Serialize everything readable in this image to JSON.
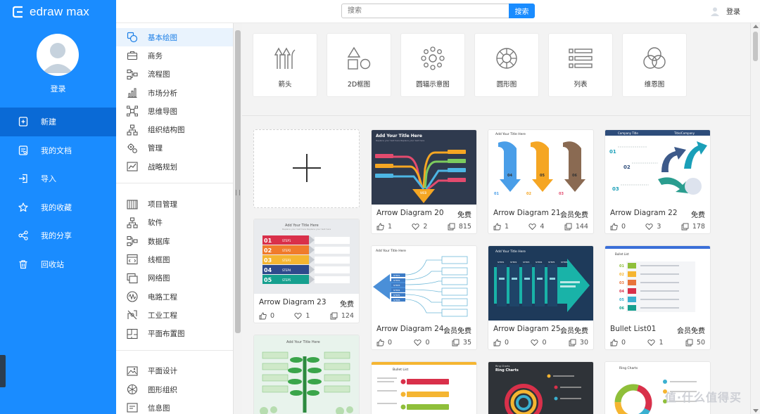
{
  "app": {
    "logo_text": "edraw max"
  },
  "sidebar": {
    "login_label": "登录",
    "items": [
      {
        "label": "新建",
        "icon": "new-file-icon",
        "active": true
      },
      {
        "label": "我的文档",
        "icon": "document-icon",
        "active": false
      },
      {
        "label": "导入",
        "icon": "import-icon",
        "active": false
      },
      {
        "label": "我的收藏",
        "icon": "star-icon",
        "active": false
      },
      {
        "label": "我的分享",
        "icon": "share-icon",
        "active": false
      },
      {
        "label": "回收站",
        "icon": "trash-icon",
        "active": false
      }
    ]
  },
  "header": {
    "search_placeholder": "搜索",
    "search_button": "搜索",
    "login": "登录"
  },
  "categories": {
    "group1": [
      "基本绘图",
      "商务",
      "流程图",
      "市场分析",
      "思维导图",
      "组织结构图",
      "管理",
      "战略规划"
    ],
    "group2": [
      "项目管理",
      "软件",
      "数据库",
      "线框图",
      "网络图",
      "电路工程",
      "工业工程",
      "平面布置图"
    ],
    "group3": [
      "平面设计",
      "图形组织",
      "信息图"
    ]
  },
  "diagram_types": [
    {
      "label": "箭头",
      "icon": "arrows-icon"
    },
    {
      "label": "2D框图",
      "icon": "2d-shapes-icon"
    },
    {
      "label": "圆辐示意图",
      "icon": "radial-icon"
    },
    {
      "label": "圆形图",
      "icon": "circle-chart-icon"
    },
    {
      "label": "列表",
      "icon": "list-icon"
    },
    {
      "label": "维恩图",
      "icon": "venn-icon"
    }
  ],
  "templates": [
    {
      "name": "Arrow Diagram 20",
      "badge": "免费",
      "likes": "1",
      "comments": "2",
      "copies": "815"
    },
    {
      "name": "Arrow Diagram 21",
      "badge": "会员免费",
      "likes": "1",
      "comments": "4",
      "copies": "144"
    },
    {
      "name": "Arrow Diagram 22",
      "badge": "免费",
      "likes": "0",
      "comments": "3",
      "copies": "178"
    },
    {
      "name": "Arrow Diagram 23",
      "badge": "免费",
      "likes": "0",
      "comments": "1",
      "copies": "124"
    },
    {
      "name": "Arrow Diagram 24",
      "badge": "会员免费",
      "likes": "0",
      "comments": "0",
      "copies": "35"
    },
    {
      "name": "Arrow Diagram 25",
      "badge": "会员免费",
      "likes": "0",
      "comments": "0",
      "copies": "30"
    },
    {
      "name": "Bullet List01",
      "badge": "会员免费",
      "likes": "0",
      "comments": "1",
      "copies": "50"
    }
  ],
  "thumb_text": {
    "t20_title": "Add Your Title Here",
    "t20_caption": "Replace your text here  Replace your text here",
    "t20_tip": "WEB",
    "t21_title": "Add Your Title Here",
    "t21_nums": [
      "01",
      "04",
      "02",
      "05",
      "03",
      "06"
    ],
    "t22_title": "Company Title",
    "t22_sub": "Title/Company",
    "t22_nums": [
      "01",
      "02",
      "03"
    ],
    "t23_title": "Add Your Title Here",
    "t23_subtitle": "Replace your text here  Replace your text here",
    "t23_steps": [
      {
        "num": "01",
        "label": "STEP1"
      },
      {
        "num": "02",
        "label": "STEP2"
      },
      {
        "num": "03",
        "label": "STEP3"
      },
      {
        "num": "04",
        "label": "STEP4"
      },
      {
        "num": "05",
        "label": "STEP5"
      }
    ],
    "t24_title": "Add Your Title Here",
    "t24_steps": [
      "STEP1",
      "STEP2",
      "STEP3",
      "STEP4",
      "STEP5",
      "STEP6"
    ],
    "t25_title": "Add Your Title Here",
    "t25_steps": [
      "STEP1",
      "STEP2",
      "STEP3",
      "STEP4",
      "STEP5",
      "STEP6"
    ],
    "tb_title": "Bullet List",
    "tb_nums": [
      "01",
      "02",
      "03",
      "04",
      "05",
      "06"
    ],
    "r1_title": "Add Your Title Here",
    "r2_title": "Bullet List",
    "r3_title": "Ring Charts",
    "r4_title": "Ring Charts"
  },
  "watermark": "值·什么值得买",
  "colors": {
    "brand": "#1a8cff",
    "brand_dark": "#0a6ad6"
  }
}
